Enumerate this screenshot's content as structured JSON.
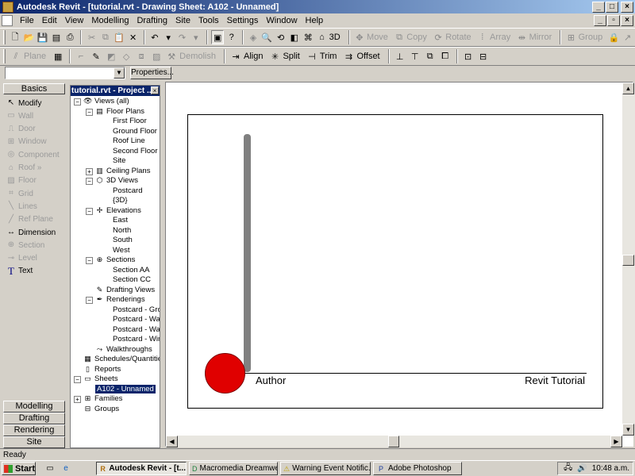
{
  "window": {
    "title": "Autodesk Revit - [tutorial.rvt - Drawing Sheet: A102 - Unnamed]"
  },
  "menu": [
    "File",
    "Edit",
    "View",
    "Modelling",
    "Drafting",
    "Site",
    "Tools",
    "Settings",
    "Window",
    "Help"
  ],
  "toolbar1": {
    "view3d": "3D",
    "move": "Move",
    "copy": "Copy",
    "rotate": "Rotate",
    "array": "Array",
    "mirror": "Mirror",
    "group": "Group"
  },
  "toolbar2": {
    "plane": "Plane",
    "demolish": "Demolish",
    "align": "Align",
    "split": "Split",
    "trim": "Trim",
    "offset": "Offset"
  },
  "typebar": {
    "type_value": "",
    "properties_label": "Properties..."
  },
  "designbar": {
    "header": "Basics",
    "items": [
      {
        "label": "Modify",
        "icon": "arrow-cursor-icon",
        "enabled": true
      },
      {
        "label": "Wall",
        "icon": "wall-icon",
        "enabled": false
      },
      {
        "label": "Door",
        "icon": "door-icon",
        "enabled": false
      },
      {
        "label": "Window",
        "icon": "window-icon",
        "enabled": false
      },
      {
        "label": "Component",
        "icon": "component-icon",
        "enabled": false
      },
      {
        "label": "Roof »",
        "icon": "roof-icon",
        "enabled": false
      },
      {
        "label": "Floor",
        "icon": "floor-icon",
        "enabled": false
      },
      {
        "label": "Grid",
        "icon": "grid-icon",
        "enabled": false
      },
      {
        "label": "Lines",
        "icon": "lines-icon",
        "enabled": false
      },
      {
        "label": "Ref Plane",
        "icon": "ref-plane-icon",
        "enabled": false
      },
      {
        "label": "Dimension",
        "icon": "dimension-icon",
        "enabled": true
      },
      {
        "label": "Section",
        "icon": "section-icon",
        "enabled": false
      },
      {
        "label": "Level",
        "icon": "level-icon",
        "enabled": false
      },
      {
        "label": "Text",
        "icon": "text-icon",
        "enabled": true
      }
    ],
    "tabs": [
      "Modelling",
      "Drafting",
      "Rendering",
      "Site"
    ]
  },
  "browser": {
    "title": "tutorial.rvt - Project ...",
    "tree": [
      {
        "label": "Views (all)",
        "level": 0,
        "expander": "-",
        "icon": "eye-icon"
      },
      {
        "label": "Floor Plans",
        "level": 1,
        "expander": "-",
        "icon": "floor-plan-icon"
      },
      {
        "label": "First Floor",
        "level": 2
      },
      {
        "label": "Ground Floor",
        "level": 2
      },
      {
        "label": "Roof Line",
        "level": 2
      },
      {
        "label": "Second Floor",
        "level": 2
      },
      {
        "label": "Site",
        "level": 2
      },
      {
        "label": "Ceiling Plans",
        "level": 1,
        "expander": "+",
        "icon": "ceiling-plan-icon"
      },
      {
        "label": "3D Views",
        "level": 1,
        "expander": "-",
        "icon": "cube-icon"
      },
      {
        "label": "Postcard",
        "level": 2
      },
      {
        "label": "{3D}",
        "level": 2
      },
      {
        "label": "Elevations",
        "level": 1,
        "expander": "-",
        "icon": "elevation-icon"
      },
      {
        "label": "East",
        "level": 2
      },
      {
        "label": "North",
        "level": 2
      },
      {
        "label": "South",
        "level": 2
      },
      {
        "label": "West",
        "level": 2
      },
      {
        "label": "Sections",
        "level": 1,
        "expander": "-",
        "icon": "section-icon"
      },
      {
        "label": "Section AA",
        "level": 2
      },
      {
        "label": "Section CC",
        "level": 2
      },
      {
        "label": "Drafting Views",
        "level": 1,
        "icon": "drafting-icon"
      },
      {
        "label": "Renderings",
        "level": 1,
        "expander": "-",
        "icon": "rendering-icon"
      },
      {
        "label": "Postcard - Grou",
        "level": 2
      },
      {
        "label": "Postcard - Wall",
        "level": 2
      },
      {
        "label": "Postcard - Wall",
        "level": 2
      },
      {
        "label": "Postcard - Wind",
        "level": 2
      },
      {
        "label": "Walkthroughs",
        "level": 1,
        "icon": "walkthrough-icon"
      },
      {
        "label": "Schedules/Quantitie",
        "level": 0,
        "icon": "schedule-icon"
      },
      {
        "label": "Reports",
        "level": 0,
        "icon": "report-icon"
      },
      {
        "label": "Sheets",
        "level": 0,
        "expander": "-",
        "icon": "sheet-icon"
      },
      {
        "label": "A102 - Unnamed",
        "level": 1,
        "selected": true
      },
      {
        "label": "Families",
        "level": 0,
        "expander": "+",
        "icon": "family-icon"
      },
      {
        "label": "Groups",
        "level": 0,
        "icon": "group-icon"
      }
    ]
  },
  "sheet": {
    "author": "Author",
    "project": "Revit Tutorial"
  },
  "status": {
    "text": "Ready"
  },
  "taskbar": {
    "start": "Start",
    "tasks": [
      {
        "label": "Autodesk Revit - [t...",
        "active": true,
        "icon": "revit-icon"
      },
      {
        "label": "Macromedia Dreamwe...",
        "active": false,
        "icon": "dreamweaver-icon"
      },
      {
        "label": "Warning Event Notific...",
        "active": false,
        "icon": "warning-icon"
      },
      {
        "label": "Adobe Photoshop",
        "active": false,
        "icon": "photoshop-icon"
      }
    ],
    "clock": "10:48 a.m."
  },
  "colors": {
    "title_bar": "#0a246a",
    "accent_dot": "#e00000",
    "face": "#d4d0c8"
  }
}
